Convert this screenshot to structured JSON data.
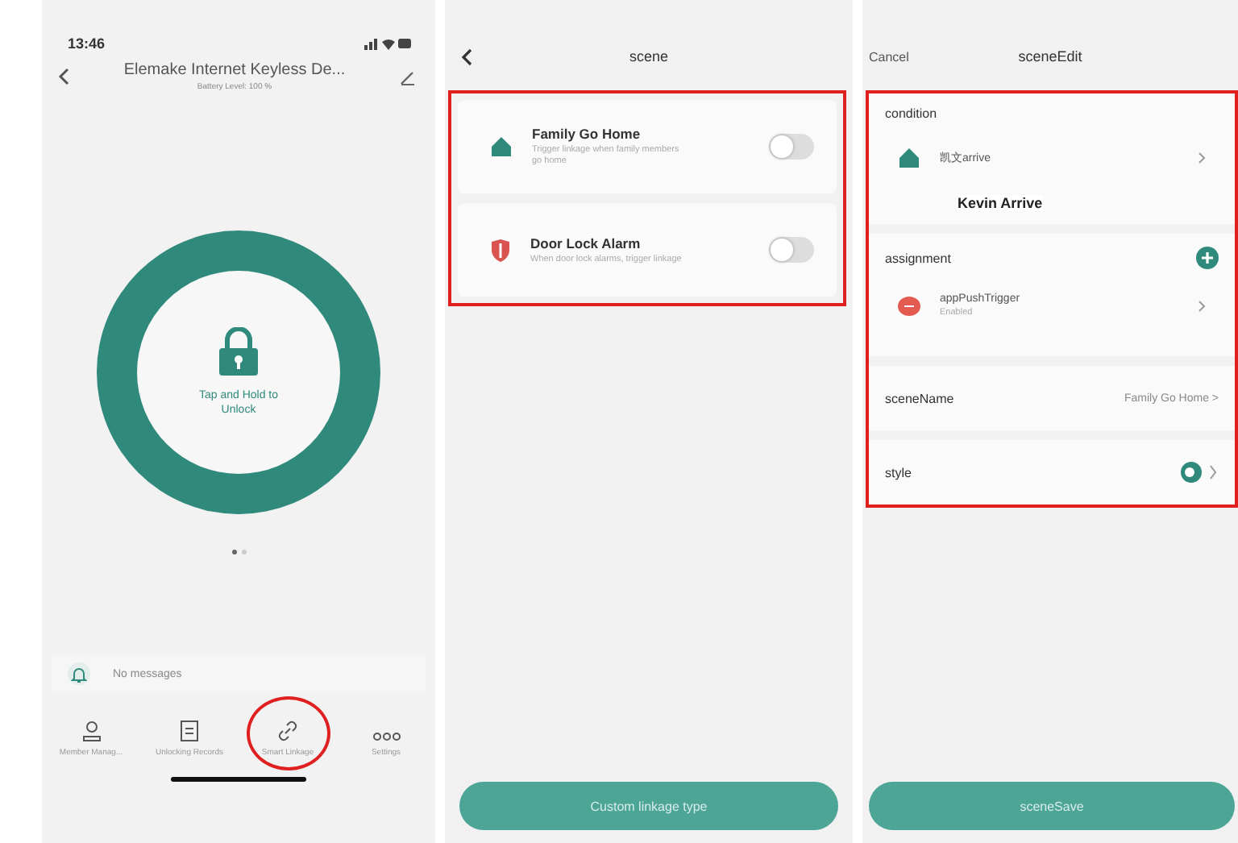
{
  "lock_screen": {
    "status_time": "13:46",
    "title": "Elemake Internet Keyless De...",
    "subtitle": "Battery Level: 100 %",
    "unlock_hint": "Tap and Hold to Unlock",
    "page_dots": [
      {
        "selected": true
      },
      {
        "selected": false
      }
    ],
    "messages": "No messages",
    "tabs": [
      {
        "label": "Member Manag...",
        "circled": false
      },
      {
        "label": "Unlocking Records",
        "circled": false
      },
      {
        "label": "Smart Linkage",
        "circled": true
      },
      {
        "label": "Settings",
        "circled": false
      }
    ]
  },
  "scene_list": {
    "title": "scene",
    "outlined": true,
    "scenes": [
      {
        "name": "Family Go Home",
        "description": "Trigger linkage when family members go home",
        "on": false
      },
      {
        "name": "Door Lock Alarm",
        "description": "When door lock alarms, trigger linkage",
        "on": false
      }
    ],
    "button": "Custom linkage type"
  },
  "scene_edit": {
    "cancel": "Cancel",
    "title": "sceneEdit",
    "outlined": true,
    "condition_label": "condition",
    "condition_item": "凯文arrive",
    "annotation": "Kevin Arrive",
    "assignment_label": "assignment",
    "assignment_item": {
      "name": "appPushTrigger",
      "status": "Enabled"
    },
    "scene_name_label": "sceneName",
    "scene_name_value": "Family Go Home >",
    "style_label": "style",
    "button": "sceneSave"
  }
}
